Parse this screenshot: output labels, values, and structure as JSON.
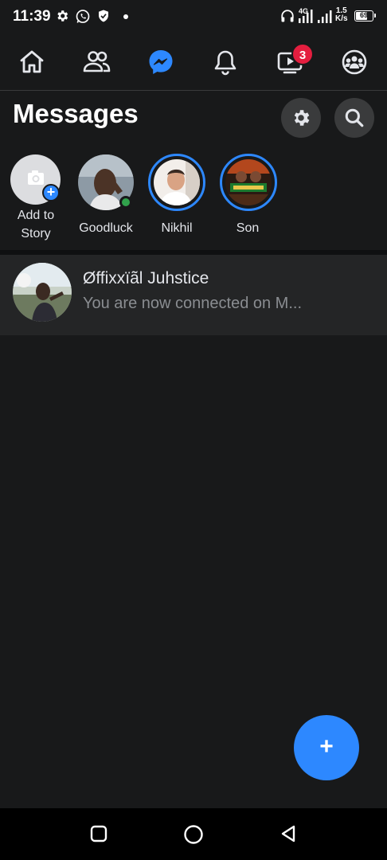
{
  "status_bar": {
    "time": "11:39",
    "network_label": "4G",
    "speed_value": "1.5",
    "speed_unit": "K/s",
    "battery_percent": 69,
    "battery_text": "69"
  },
  "top_nav": {
    "items": [
      "home",
      "friends",
      "messenger",
      "notifications",
      "watch",
      "groups"
    ],
    "active": "messenger",
    "watch_badge": "3"
  },
  "header": {
    "title": "Messages"
  },
  "stories": [
    {
      "label": "Add to Story"
    },
    {
      "label": "Goodluck",
      "online": true
    },
    {
      "label": "Nikhil"
    },
    {
      "label": "Son"
    }
  ],
  "conversations": [
    {
      "name": "Øffixxïãl Juhstice",
      "preview": "You are now connected on M..."
    }
  ],
  "fab": {
    "label": "+"
  },
  "colors": {
    "background": "#18191a",
    "surface": "#242526",
    "accent": "#2d88ff",
    "badge": "#e41e3f",
    "online": "#31a24c"
  }
}
